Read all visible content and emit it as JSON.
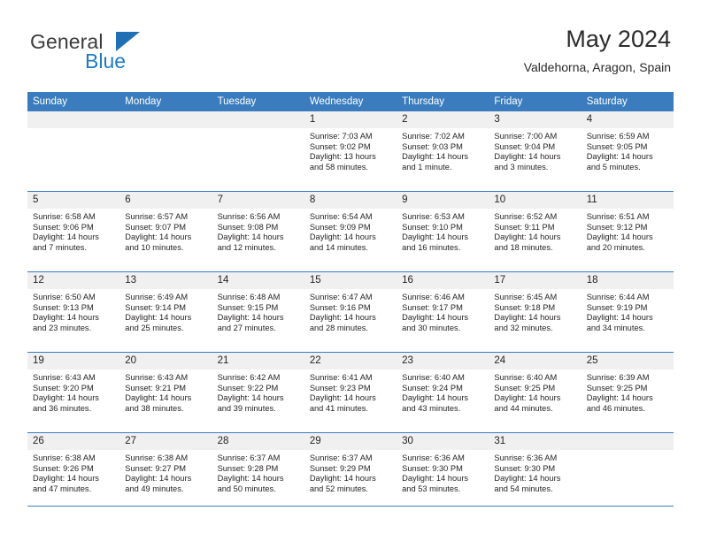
{
  "brand": {
    "name_part1": "General",
    "name_part2": "Blue",
    "triangle_icon": "triangle-icon"
  },
  "header": {
    "title": "May 2024",
    "subtitle": "Valdehorna, Aragon, Spain"
  },
  "colors": {
    "header_blue": "#3a7cbe",
    "brand_blue": "#1f7ac4",
    "daynum_band": "#f0f0f0",
    "text": "#231f20"
  },
  "weekday_headers": [
    "Sunday",
    "Monday",
    "Tuesday",
    "Wednesday",
    "Thursday",
    "Friday",
    "Saturday"
  ],
  "weeks": [
    [
      {
        "day": "",
        "empty": true,
        "sunrise": "",
        "sunset": "",
        "daylight_line1": "",
        "daylight_line2": ""
      },
      {
        "day": "",
        "empty": true,
        "sunrise": "",
        "sunset": "",
        "daylight_line1": "",
        "daylight_line2": ""
      },
      {
        "day": "",
        "empty": true,
        "sunrise": "",
        "sunset": "",
        "daylight_line1": "",
        "daylight_line2": ""
      },
      {
        "day": "1",
        "empty": false,
        "sunrise": "Sunrise: 7:03 AM",
        "sunset": "Sunset: 9:02 PM",
        "daylight_line1": "Daylight: 13 hours",
        "daylight_line2": "and 58 minutes."
      },
      {
        "day": "2",
        "empty": false,
        "sunrise": "Sunrise: 7:02 AM",
        "sunset": "Sunset: 9:03 PM",
        "daylight_line1": "Daylight: 14 hours",
        "daylight_line2": "and 1 minute."
      },
      {
        "day": "3",
        "empty": false,
        "sunrise": "Sunrise: 7:00 AM",
        "sunset": "Sunset: 9:04 PM",
        "daylight_line1": "Daylight: 14 hours",
        "daylight_line2": "and 3 minutes."
      },
      {
        "day": "4",
        "empty": false,
        "sunrise": "Sunrise: 6:59 AM",
        "sunset": "Sunset: 9:05 PM",
        "daylight_line1": "Daylight: 14 hours",
        "daylight_line2": "and 5 minutes."
      }
    ],
    [
      {
        "day": "5",
        "empty": false,
        "sunrise": "Sunrise: 6:58 AM",
        "sunset": "Sunset: 9:06 PM",
        "daylight_line1": "Daylight: 14 hours",
        "daylight_line2": "and 7 minutes."
      },
      {
        "day": "6",
        "empty": false,
        "sunrise": "Sunrise: 6:57 AM",
        "sunset": "Sunset: 9:07 PM",
        "daylight_line1": "Daylight: 14 hours",
        "daylight_line2": "and 10 minutes."
      },
      {
        "day": "7",
        "empty": false,
        "sunrise": "Sunrise: 6:56 AM",
        "sunset": "Sunset: 9:08 PM",
        "daylight_line1": "Daylight: 14 hours",
        "daylight_line2": "and 12 minutes."
      },
      {
        "day": "8",
        "empty": false,
        "sunrise": "Sunrise: 6:54 AM",
        "sunset": "Sunset: 9:09 PM",
        "daylight_line1": "Daylight: 14 hours",
        "daylight_line2": "and 14 minutes."
      },
      {
        "day": "9",
        "empty": false,
        "sunrise": "Sunrise: 6:53 AM",
        "sunset": "Sunset: 9:10 PM",
        "daylight_line1": "Daylight: 14 hours",
        "daylight_line2": "and 16 minutes."
      },
      {
        "day": "10",
        "empty": false,
        "sunrise": "Sunrise: 6:52 AM",
        "sunset": "Sunset: 9:11 PM",
        "daylight_line1": "Daylight: 14 hours",
        "daylight_line2": "and 18 minutes."
      },
      {
        "day": "11",
        "empty": false,
        "sunrise": "Sunrise: 6:51 AM",
        "sunset": "Sunset: 9:12 PM",
        "daylight_line1": "Daylight: 14 hours",
        "daylight_line2": "and 20 minutes."
      }
    ],
    [
      {
        "day": "12",
        "empty": false,
        "sunrise": "Sunrise: 6:50 AM",
        "sunset": "Sunset: 9:13 PM",
        "daylight_line1": "Daylight: 14 hours",
        "daylight_line2": "and 23 minutes."
      },
      {
        "day": "13",
        "empty": false,
        "sunrise": "Sunrise: 6:49 AM",
        "sunset": "Sunset: 9:14 PM",
        "daylight_line1": "Daylight: 14 hours",
        "daylight_line2": "and 25 minutes."
      },
      {
        "day": "14",
        "empty": false,
        "sunrise": "Sunrise: 6:48 AM",
        "sunset": "Sunset: 9:15 PM",
        "daylight_line1": "Daylight: 14 hours",
        "daylight_line2": "and 27 minutes."
      },
      {
        "day": "15",
        "empty": false,
        "sunrise": "Sunrise: 6:47 AM",
        "sunset": "Sunset: 9:16 PM",
        "daylight_line1": "Daylight: 14 hours",
        "daylight_line2": "and 28 minutes."
      },
      {
        "day": "16",
        "empty": false,
        "sunrise": "Sunrise: 6:46 AM",
        "sunset": "Sunset: 9:17 PM",
        "daylight_line1": "Daylight: 14 hours",
        "daylight_line2": "and 30 minutes."
      },
      {
        "day": "17",
        "empty": false,
        "sunrise": "Sunrise: 6:45 AM",
        "sunset": "Sunset: 9:18 PM",
        "daylight_line1": "Daylight: 14 hours",
        "daylight_line2": "and 32 minutes."
      },
      {
        "day": "18",
        "empty": false,
        "sunrise": "Sunrise: 6:44 AM",
        "sunset": "Sunset: 9:19 PM",
        "daylight_line1": "Daylight: 14 hours",
        "daylight_line2": "and 34 minutes."
      }
    ],
    [
      {
        "day": "19",
        "empty": false,
        "sunrise": "Sunrise: 6:43 AM",
        "sunset": "Sunset: 9:20 PM",
        "daylight_line1": "Daylight: 14 hours",
        "daylight_line2": "and 36 minutes."
      },
      {
        "day": "20",
        "empty": false,
        "sunrise": "Sunrise: 6:43 AM",
        "sunset": "Sunset: 9:21 PM",
        "daylight_line1": "Daylight: 14 hours",
        "daylight_line2": "and 38 minutes."
      },
      {
        "day": "21",
        "empty": false,
        "sunrise": "Sunrise: 6:42 AM",
        "sunset": "Sunset: 9:22 PM",
        "daylight_line1": "Daylight: 14 hours",
        "daylight_line2": "and 39 minutes."
      },
      {
        "day": "22",
        "empty": false,
        "sunrise": "Sunrise: 6:41 AM",
        "sunset": "Sunset: 9:23 PM",
        "daylight_line1": "Daylight: 14 hours",
        "daylight_line2": "and 41 minutes."
      },
      {
        "day": "23",
        "empty": false,
        "sunrise": "Sunrise: 6:40 AM",
        "sunset": "Sunset: 9:24 PM",
        "daylight_line1": "Daylight: 14 hours",
        "daylight_line2": "and 43 minutes."
      },
      {
        "day": "24",
        "empty": false,
        "sunrise": "Sunrise: 6:40 AM",
        "sunset": "Sunset: 9:25 PM",
        "daylight_line1": "Daylight: 14 hours",
        "daylight_line2": "and 44 minutes."
      },
      {
        "day": "25",
        "empty": false,
        "sunrise": "Sunrise: 6:39 AM",
        "sunset": "Sunset: 9:25 PM",
        "daylight_line1": "Daylight: 14 hours",
        "daylight_line2": "and 46 minutes."
      }
    ],
    [
      {
        "day": "26",
        "empty": false,
        "sunrise": "Sunrise: 6:38 AM",
        "sunset": "Sunset: 9:26 PM",
        "daylight_line1": "Daylight: 14 hours",
        "daylight_line2": "and 47 minutes."
      },
      {
        "day": "27",
        "empty": false,
        "sunrise": "Sunrise: 6:38 AM",
        "sunset": "Sunset: 9:27 PM",
        "daylight_line1": "Daylight: 14 hours",
        "daylight_line2": "and 49 minutes."
      },
      {
        "day": "28",
        "empty": false,
        "sunrise": "Sunrise: 6:37 AM",
        "sunset": "Sunset: 9:28 PM",
        "daylight_line1": "Daylight: 14 hours",
        "daylight_line2": "and 50 minutes."
      },
      {
        "day": "29",
        "empty": false,
        "sunrise": "Sunrise: 6:37 AM",
        "sunset": "Sunset: 9:29 PM",
        "daylight_line1": "Daylight: 14 hours",
        "daylight_line2": "and 52 minutes."
      },
      {
        "day": "30",
        "empty": false,
        "sunrise": "Sunrise: 6:36 AM",
        "sunset": "Sunset: 9:30 PM",
        "daylight_line1": "Daylight: 14 hours",
        "daylight_line2": "and 53 minutes."
      },
      {
        "day": "31",
        "empty": false,
        "sunrise": "Sunrise: 6:36 AM",
        "sunset": "Sunset: 9:30 PM",
        "daylight_line1": "Daylight: 14 hours",
        "daylight_line2": "and 54 minutes."
      },
      {
        "day": "",
        "empty": true,
        "sunrise": "",
        "sunset": "",
        "daylight_line1": "",
        "daylight_line2": ""
      }
    ]
  ]
}
